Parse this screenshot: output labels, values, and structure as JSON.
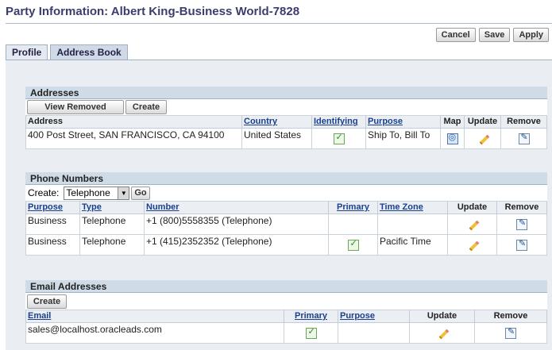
{
  "page": {
    "title": "Party Information: Albert King-Business World-7828"
  },
  "actions": {
    "cancel": "Cancel",
    "save": "Save",
    "apply": "Apply"
  },
  "tabs": [
    {
      "label": "Profile"
    },
    {
      "label": "Address Book"
    }
  ],
  "addresses": {
    "heading": "Addresses",
    "buttons": {
      "view_removed": "View Removed",
      "create": "Create"
    },
    "columns": {
      "address": "Address",
      "country": "Country",
      "identifying": "Identifying",
      "purpose": "Purpose",
      "map": "Map",
      "update": "Update",
      "remove": "Remove"
    },
    "rows": [
      {
        "address": "400 Post Street, SAN FRANCISCO, CA 94100",
        "country": "United States",
        "purpose": "Ship To, Bill To"
      }
    ]
  },
  "phones": {
    "heading": "Phone Numbers",
    "create_label": "Create:",
    "create_select": "Telephone",
    "go": "Go",
    "columns": {
      "purpose": "Purpose",
      "type": "Type",
      "number": "Number",
      "primary": "Primary",
      "timezone": "Time Zone",
      "update": "Update",
      "remove": "Remove"
    },
    "rows": [
      {
        "purpose": "Business",
        "type": "Telephone",
        "number": "+1 (800)5558355 (Telephone)",
        "primary": false,
        "timezone": ""
      },
      {
        "purpose": "Business",
        "type": "Telephone",
        "number": "+1 (415)2352352 (Telephone)",
        "primary": true,
        "timezone": "Pacific Time"
      }
    ]
  },
  "emails": {
    "heading": "Email Addresses",
    "create": "Create",
    "columns": {
      "email": "Email",
      "primary": "Primary",
      "purpose": "Purpose",
      "update": "Update",
      "remove": "Remove"
    },
    "rows": [
      {
        "email": "sales@localhost.oracleads.com",
        "primary": true,
        "purpose": ""
      }
    ]
  }
}
